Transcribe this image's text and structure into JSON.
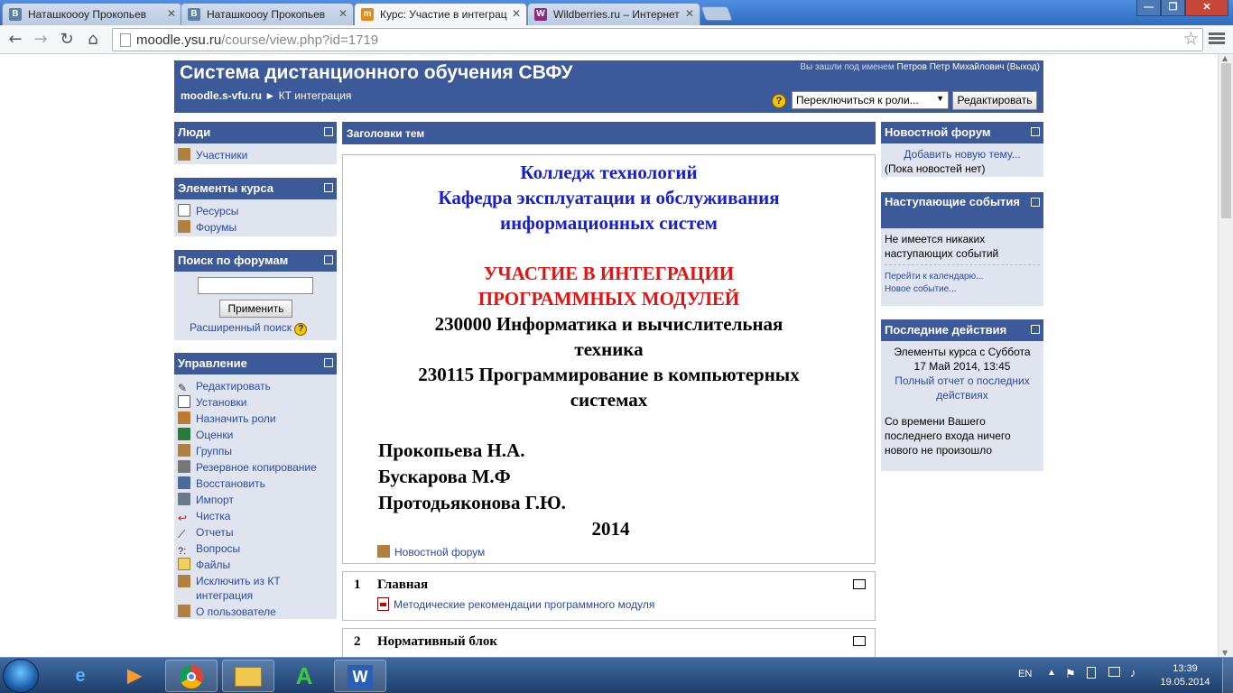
{
  "browser": {
    "tabs": [
      {
        "label": "Наташкоооу Прокопьев",
        "icon": "vk-icon",
        "icon_letter": "В",
        "icon_color": "#5b7fa6",
        "active": false
      },
      {
        "label": "Наташкоооу Прокопьев",
        "icon": "vk-icon",
        "icon_letter": "В",
        "icon_color": "#5b7fa6",
        "active": false
      },
      {
        "label": "Курс: Участие в интеграц",
        "icon": "moodle-icon",
        "icon_letter": "m",
        "icon_color": "#e08a1e",
        "active": true
      },
      {
        "label": "Wildberries.ru – Интернет",
        "icon": "wildberries-icon",
        "icon_letter": "W",
        "icon_color": "#8a2d7e",
        "active": false
      }
    ],
    "url_host": "moodle.ysu.ru",
    "url_path": "/course/view.php?id=1719"
  },
  "header": {
    "site_title": "Система дистанционного обучения СВФУ",
    "breadcrumb_home": "moodle.s-vfu.ru",
    "breadcrumb_sep": "►",
    "breadcrumb_current": "КТ интеграция",
    "login_prefix": "Вы зашли под именем",
    "login_user": "Петров Петр Михайлович",
    "logout": "(Выход)",
    "role_select": "Переключиться к роли...",
    "edit_button": "Редактировать"
  },
  "left_blocks": {
    "people": {
      "title": "Люди",
      "items": [
        "Участники"
      ]
    },
    "activities": {
      "title": "Элементы курса",
      "items": [
        "Ресурсы",
        "Форумы"
      ]
    },
    "search": {
      "title": "Поиск по форумам",
      "button": "Применить",
      "advanced": "Расширенный поиск"
    },
    "admin": {
      "title": "Управление",
      "items": [
        "Редактировать",
        "Установки",
        "Назначить роли",
        "Оценки",
        "Группы",
        "Резервное копирование",
        "Восстановить",
        "Импорт",
        "Чистка",
        "Отчеты",
        "Вопросы",
        "Файлы",
        "Исключить из КТ интеграция",
        "О пользователе"
      ]
    }
  },
  "main": {
    "topics_header": "Заголовки тем",
    "intro": {
      "line1": "Колледж технологий",
      "line2": "Кафедра эксплуатации и обслуживания",
      "line3": "информационных систем",
      "title1": "УЧАСТИЕ В ИНТЕГРАЦИИ",
      "title2": "ПРОГРАММНЫХ МОДУЛЕЙ",
      "spec1a": "230000 Информатика и вычислительная",
      "spec1b": "техника",
      "spec2a": "230115 Программирование в компьютерных",
      "spec2b": "системах",
      "author1": "Прокопьева Н.А.",
      "author2": "Бускарова М.Ф",
      "author3": "Протодьяконова Г.Ю.",
      "year": "2014",
      "forum_link": "Новостной форум"
    },
    "sections": [
      {
        "num": "1",
        "title": "Главная",
        "link": "Методические рекомендации программного модуля"
      },
      {
        "num": "2",
        "title": "Нормативный блок"
      }
    ]
  },
  "right_blocks": {
    "news": {
      "title": "Новостной форум",
      "add": "Добавить новую тему...",
      "empty": "(Пока новостей нет)"
    },
    "events": {
      "title": "Наступающие события",
      "empty": "Не имеется никаких наступающих событий",
      "calendar": "Перейти к календарю...",
      "new_event": "Новое событие..."
    },
    "recent": {
      "title": "Последние действия",
      "since": "Элементы курса с Суббота 17 Май 2014, 13:45",
      "full_report": "Полный отчет о последних действиях",
      "nothing": "Со времени Вашего последнего входа ничего нового не произошло"
    }
  },
  "taskbar": {
    "lang": "EN",
    "time": "13:39",
    "date": "19.05.2014",
    "apps": [
      "windows-start-icon",
      "ie-icon",
      "media-player-icon",
      "chrome-icon",
      "explorer-icon",
      "app-a-icon",
      "word-icon"
    ]
  }
}
